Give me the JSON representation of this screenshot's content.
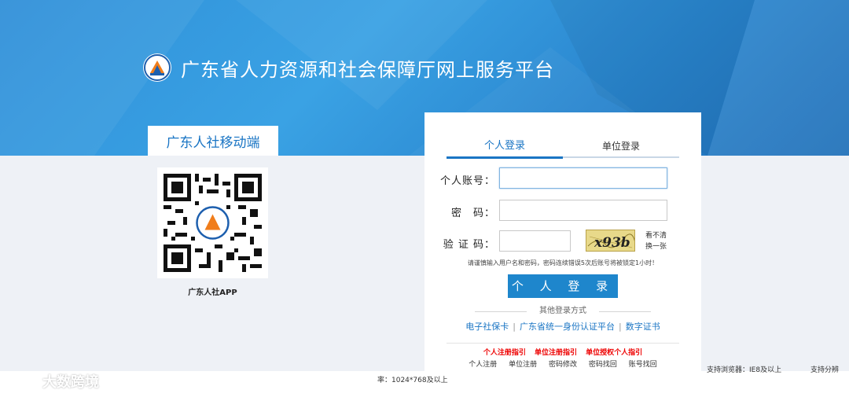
{
  "header": {
    "title": "广东省人力资源和社会保障厅网上服务平台"
  },
  "mobile": {
    "tab_label": "广东人社移动端",
    "app_label": "广东人社APP"
  },
  "login": {
    "tabs": [
      "个人登录",
      "单位登录"
    ],
    "account_label": "个人账号：",
    "password_label": "密　码：",
    "captcha_label": "验 证 码：",
    "captcha_text": "x93b",
    "refresh_label": "看不清换一张",
    "hint": "请谨慎输入用户名和密码，密码连续错误5次后账号将被锁定1小时！",
    "submit_label": "个 人 登 录",
    "other_title": "其他登录方式",
    "alt_methods": [
      "电子社保卡",
      "广东省统一身份认证平台",
      "数字证书"
    ],
    "guides": [
      "个人注册指引",
      "单位注册指引",
      "单位授权个人指引"
    ],
    "bottom_links": [
      "个人注册",
      "单位注册",
      "密码修改",
      "密码找回",
      "账号找回"
    ]
  },
  "footer": {
    "resolution_note": "率：1024*768及以上",
    "browser_note": "支持浏览器：IE8及以上",
    "browser_note2": "支持分辨",
    "watermark": "大数跨境"
  },
  "colors": {
    "accent": "#1a75c4",
    "banner": "#2f8fd8",
    "guide_red": "#ee0000"
  }
}
